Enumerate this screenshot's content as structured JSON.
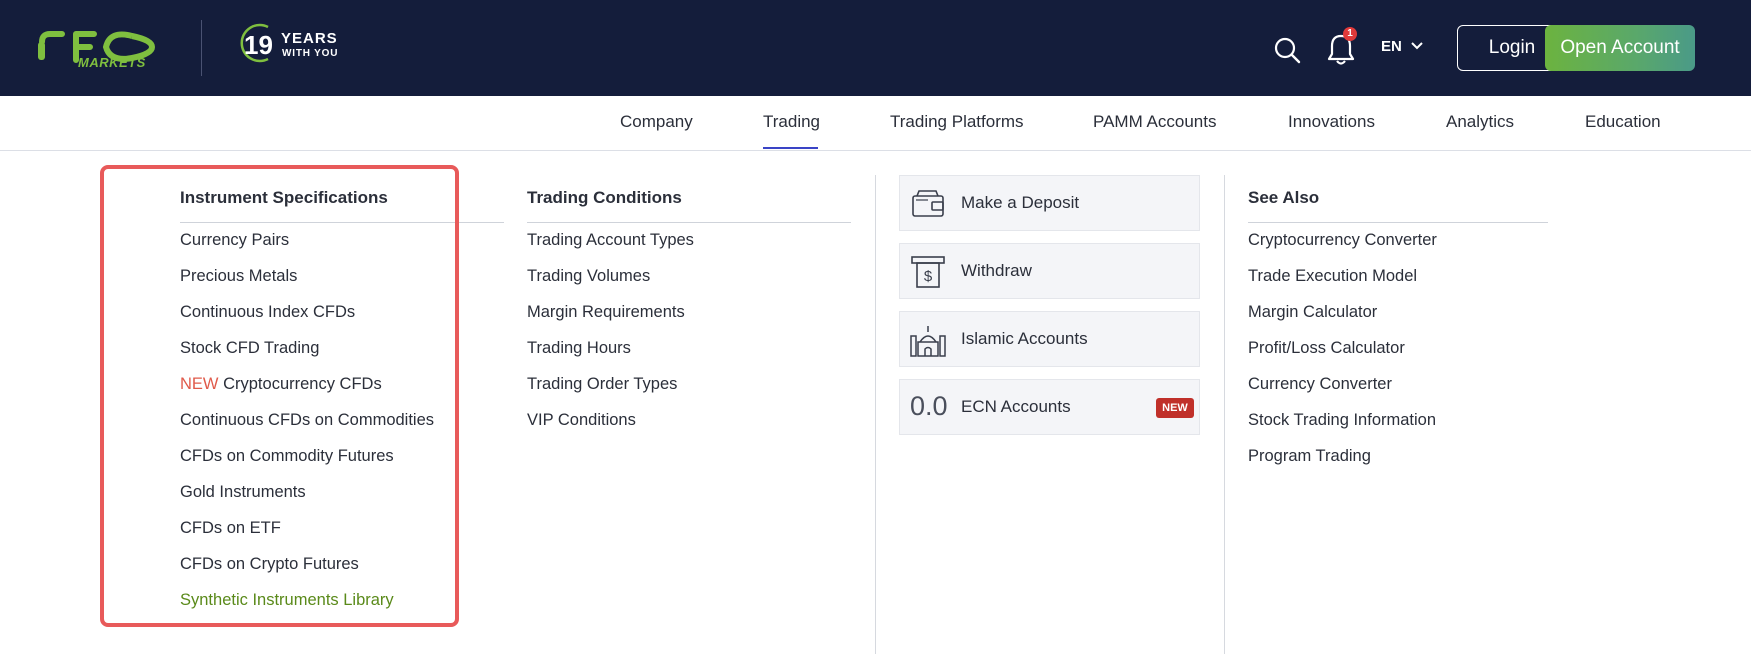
{
  "header": {
    "logo_text": "IFC",
    "logo_sub": "MARKETS",
    "years_number": "19",
    "years_line1": "YEARS",
    "years_line2": "WITH YOU",
    "search_icon": "search-icon",
    "bell_icon": "bell-icon",
    "notification_count": "1",
    "language": "EN",
    "login_label": "Login",
    "open_account_label": "Open Account"
  },
  "nav": {
    "items": [
      "Company",
      "Trading",
      "Trading Platforms",
      "PAMM Accounts",
      "Innovations",
      "Analytics",
      "Education"
    ],
    "active": "Trading"
  },
  "menu": {
    "instrument_specs": {
      "heading": "Instrument Specifications",
      "links": [
        "Currency Pairs",
        "Precious Metals",
        "Continuous Index CFDs",
        "Stock CFD Trading",
        "Cryptocurrency CFDs",
        "Continuous CFDs on Commodities",
        "CFDs on Commodity Futures",
        "Gold Instruments",
        "CFDs on ETF",
        "CFDs on Crypto Futures",
        "Synthetic Instruments Library"
      ],
      "new_tag": "NEW"
    },
    "trading_conditions": {
      "heading": "Trading Conditions",
      "links": [
        "Trading Account Types",
        "Trading Volumes",
        "Margin Requirements",
        "Trading Hours",
        "Trading Order Types",
        "VIP Conditions"
      ]
    },
    "cards": [
      {
        "label": "Make a Deposit",
        "icon": "wallet-icon"
      },
      {
        "label": "Withdraw",
        "icon": "atm-withdraw-icon"
      },
      {
        "label": "Islamic Accounts",
        "icon": "mosque-icon"
      },
      {
        "label": "ECN Accounts",
        "big_text": "0.0",
        "badge": "NEW"
      }
    ],
    "see_also": {
      "heading": "See Also",
      "links": [
        "Cryptocurrency Converter",
        "Trade Execution Model",
        "Margin Calculator",
        "Profit/Loss Calculator",
        "Currency Converter",
        "Stock Trading Information",
        "Program Trading"
      ]
    }
  },
  "colors": {
    "header_bg": "#141d3b",
    "accent_green": "#6cb33f",
    "nav_underline": "#3a44c6",
    "highlight_red": "#e85a5a",
    "new_red": "#e05a4a"
  }
}
